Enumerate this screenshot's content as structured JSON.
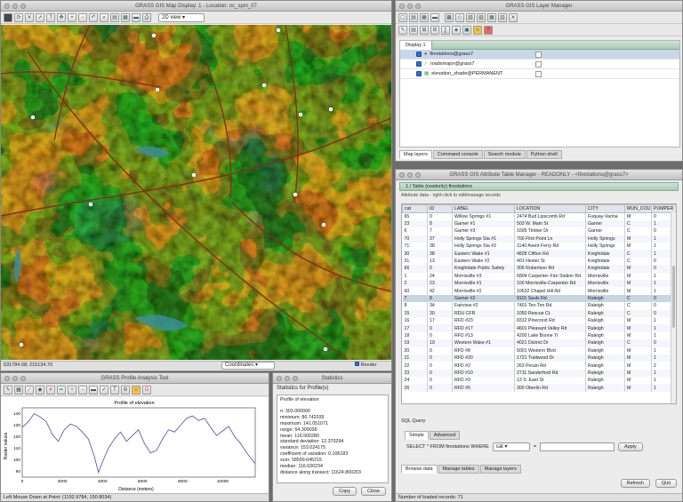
{
  "map_display": {
    "title": "GRASS GIS Map Display: 1 - Location: nc_spm_07",
    "view_mode": "2D view",
    "coords": "631784.08; 215134.70",
    "mode_select": "Coordinates",
    "render_label": "Render",
    "toolbar_icons": [
      "display-icon",
      "render-icon",
      "erase-icon",
      "pointer-icon",
      "query-icon",
      "pan-icon",
      "zoom-in-icon",
      "zoom-out-icon",
      "zoom-back-icon",
      "zoom-menu-icon",
      "analyze-icon",
      "overlay-icon",
      "save-icon",
      "print-icon"
    ]
  },
  "layer_manager": {
    "title": "GRASS GIS Layer Manager",
    "display_tab": "Display 1",
    "layers": [
      {
        "name": "firestations@grass7",
        "selected": true
      },
      {
        "name": "roadsmajor@grass7",
        "selected": false
      },
      {
        "name": "elevation_shade@PERMANENT",
        "selected": false
      }
    ],
    "bottom_tabs": [
      "Map layers",
      "Command console",
      "Search module",
      "Python shell"
    ]
  },
  "attr_manager": {
    "title": "GRASS GIS Attribute Table Manager - READONLY - <firestations@grass7>",
    "table_tab": "1 / Table (readonly) firestations",
    "hint": "Attribute data - right-click to edit/manage records",
    "columns": [
      "cat",
      "ID",
      "LABEL",
      "LOCATION",
      "CITY",
      "MUN_COU",
      "PUMPER"
    ],
    "rows": [
      [
        "65",
        "0",
        "Willow Springs #1",
        "2474 Bud Lipscomb Rd",
        "Fuquay-Varina",
        "M",
        "0"
      ],
      [
        "23",
        "8",
        "Garner #1",
        "503 W. Main St",
        "Garner",
        "C",
        "1"
      ],
      [
        "6",
        "7",
        "Garner #3",
        "1695 Timber Dr",
        "Garner",
        "C",
        "0"
      ],
      [
        "70",
        "37",
        "Holly Springs Sta #1",
        "700 Flint Point Ln",
        "Holly Springs",
        "M",
        "1"
      ],
      [
        "71",
        "38",
        "Holly Springs Sta #2",
        "1140 Avent Ferry Rd",
        "Holly Springs",
        "M",
        "1"
      ],
      [
        "30",
        "38",
        "Eastern Wake #1",
        "4828 Clifton Rd",
        "Knightdale",
        "C",
        "1"
      ],
      [
        "31",
        "13",
        "Eastern Wake #2",
        "401 Hester St",
        "Knightdale",
        "C",
        "0"
      ],
      [
        "66",
        "0",
        "Knightdale Public Safety",
        "306 Robertson Rd",
        "Knightdale",
        "M",
        "0"
      ],
      [
        "1",
        "24",
        "Morrisville #3",
        "6804 Carpenter Fire Station Rd",
        "Morrisville",
        "M",
        "1"
      ],
      [
        "2",
        "23",
        "Morrisville #1",
        "100 Morrisville-Carpenter Rd",
        "Morrisville",
        "M",
        "1"
      ],
      [
        "60",
        "42",
        "Morrisville #2",
        "10632 Chapel Hill Rd",
        "Morrisville",
        "M",
        "1"
      ],
      [
        "7",
        "8",
        "Garner #2",
        "9115 Sauls Rd",
        "Raleigh",
        "C",
        "0"
      ],
      [
        "8",
        "34",
        "Fairview #2",
        "7401 Ten-Ten Rd",
        "Raleigh",
        "C",
        "0"
      ],
      [
        "15",
        "30",
        "RDU CFR",
        "1050 Rescue Ct",
        "Raleigh",
        "C",
        "0"
      ],
      [
        "16",
        "17",
        "RFD #23",
        "8312 Pinecrest Rd",
        "Raleigh",
        "M",
        "1"
      ],
      [
        "17",
        "0",
        "RFD #17",
        "4601 Pleasant Valley Rd",
        "Raleigh",
        "M",
        "1"
      ],
      [
        "18",
        "0",
        "RFD #13",
        "4200 Lake Boone Tr",
        "Raleigh",
        "M",
        "1"
      ],
      [
        "19",
        "19",
        "Western Wake #1",
        "4021 District Dr",
        "Raleigh",
        "C",
        "0"
      ],
      [
        "20",
        "0",
        "RFD #8",
        "5001 Western Blvd",
        "Raleigh",
        "M",
        "1"
      ],
      [
        "21",
        "0",
        "RFD #20",
        "1721 Trailwood Dr",
        "Raleigh",
        "M",
        "1"
      ],
      [
        "22",
        "0",
        "RFD #2",
        "263 Pecan Rd",
        "Raleigh",
        "M",
        "2"
      ],
      [
        "23",
        "0",
        "RFD #10",
        "2711 Sanderford Rd",
        "Raleigh",
        "M",
        "1"
      ],
      [
        "24",
        "0",
        "RFD #3",
        "13 S. East St",
        "Raleigh",
        "M",
        "1"
      ],
      [
        "26",
        "0",
        "RFD #5",
        "300 Oberlin Rd",
        "Raleigh",
        "M",
        "1"
      ]
    ],
    "sql_label": "SQL Query",
    "sql_tabs": [
      "Simple",
      "Advanced"
    ],
    "sql_prefix": "SELECT * FROM firestations WHERE",
    "sql_column": "cat",
    "sql_operator": "=",
    "apply": "Apply",
    "bottom_tabs": [
      "Browse data",
      "Manage tables",
      "Manage layers"
    ],
    "refresh": "Refresh",
    "quit": "Quit",
    "status": "Number of loaded records: 71"
  },
  "profile_tool": {
    "title": "GRASS Profile Analysis Tool",
    "plot_title": "Profile of elevation",
    "xlabel": "Distance (meters)",
    "ylabel": "Raster values",
    "status": "Left Mouse Down at Point: (1192.9784, 150.8034)"
  },
  "stats_window": {
    "title": "Statistics",
    "heading": "Statistics for Profile(s)",
    "subheading": "Profile of elevation",
    "lines": [
      "n: 303.000000",
      "minimum: 86.742035",
      "maximum: 141.051071",
      "range: 54.309036",
      "mean: 116.500280",
      "standard deviation: 12.370294",
      "variance: 153.024175",
      "coefficient of variation: 0.106183",
      "sum: 58599.645215",
      "median: 116.630234",
      "distance along transect: 11624.800203"
    ],
    "copy": "Copy",
    "close": "Close"
  },
  "chart_data": {
    "type": "line",
    "title": "Profile of elevation",
    "xlabel": "Distance (meters)",
    "ylabel": "Raster values",
    "xlim": [
      0,
      11624
    ],
    "ylim": [
      85,
      145
    ],
    "xticks": [
      0,
      2000,
      4000,
      6000,
      8000,
      10000
    ],
    "yticks": [
      90,
      100,
      110,
      120,
      130,
      140
    ],
    "series": [
      {
        "x": [
          0,
          300,
          600,
          900,
          1200,
          1500,
          1800,
          2100,
          2400,
          2700,
          3000,
          3300,
          3600,
          3800,
          4000,
          4300,
          4600,
          4900,
          5200,
          5500,
          5800,
          6100,
          6400,
          6700,
          7000,
          7300,
          7600,
          7900,
          8200,
          8500,
          8800,
          9100,
          9400,
          9700,
          10000,
          10300,
          10600,
          10900,
          11200,
          11600
        ],
        "values": [
          128,
          133,
          140,
          137,
          133,
          122,
          116,
          126,
          131,
          129,
          124,
          118,
          103,
          89,
          98,
          110,
          118,
          124,
          116,
          121,
          126,
          114,
          106,
          108,
          118,
          126,
          124,
          130,
          136,
          138,
          134,
          136,
          128,
          121,
          125,
          129,
          120,
          114,
          106,
          97
        ]
      }
    ],
    "grid": false
  }
}
